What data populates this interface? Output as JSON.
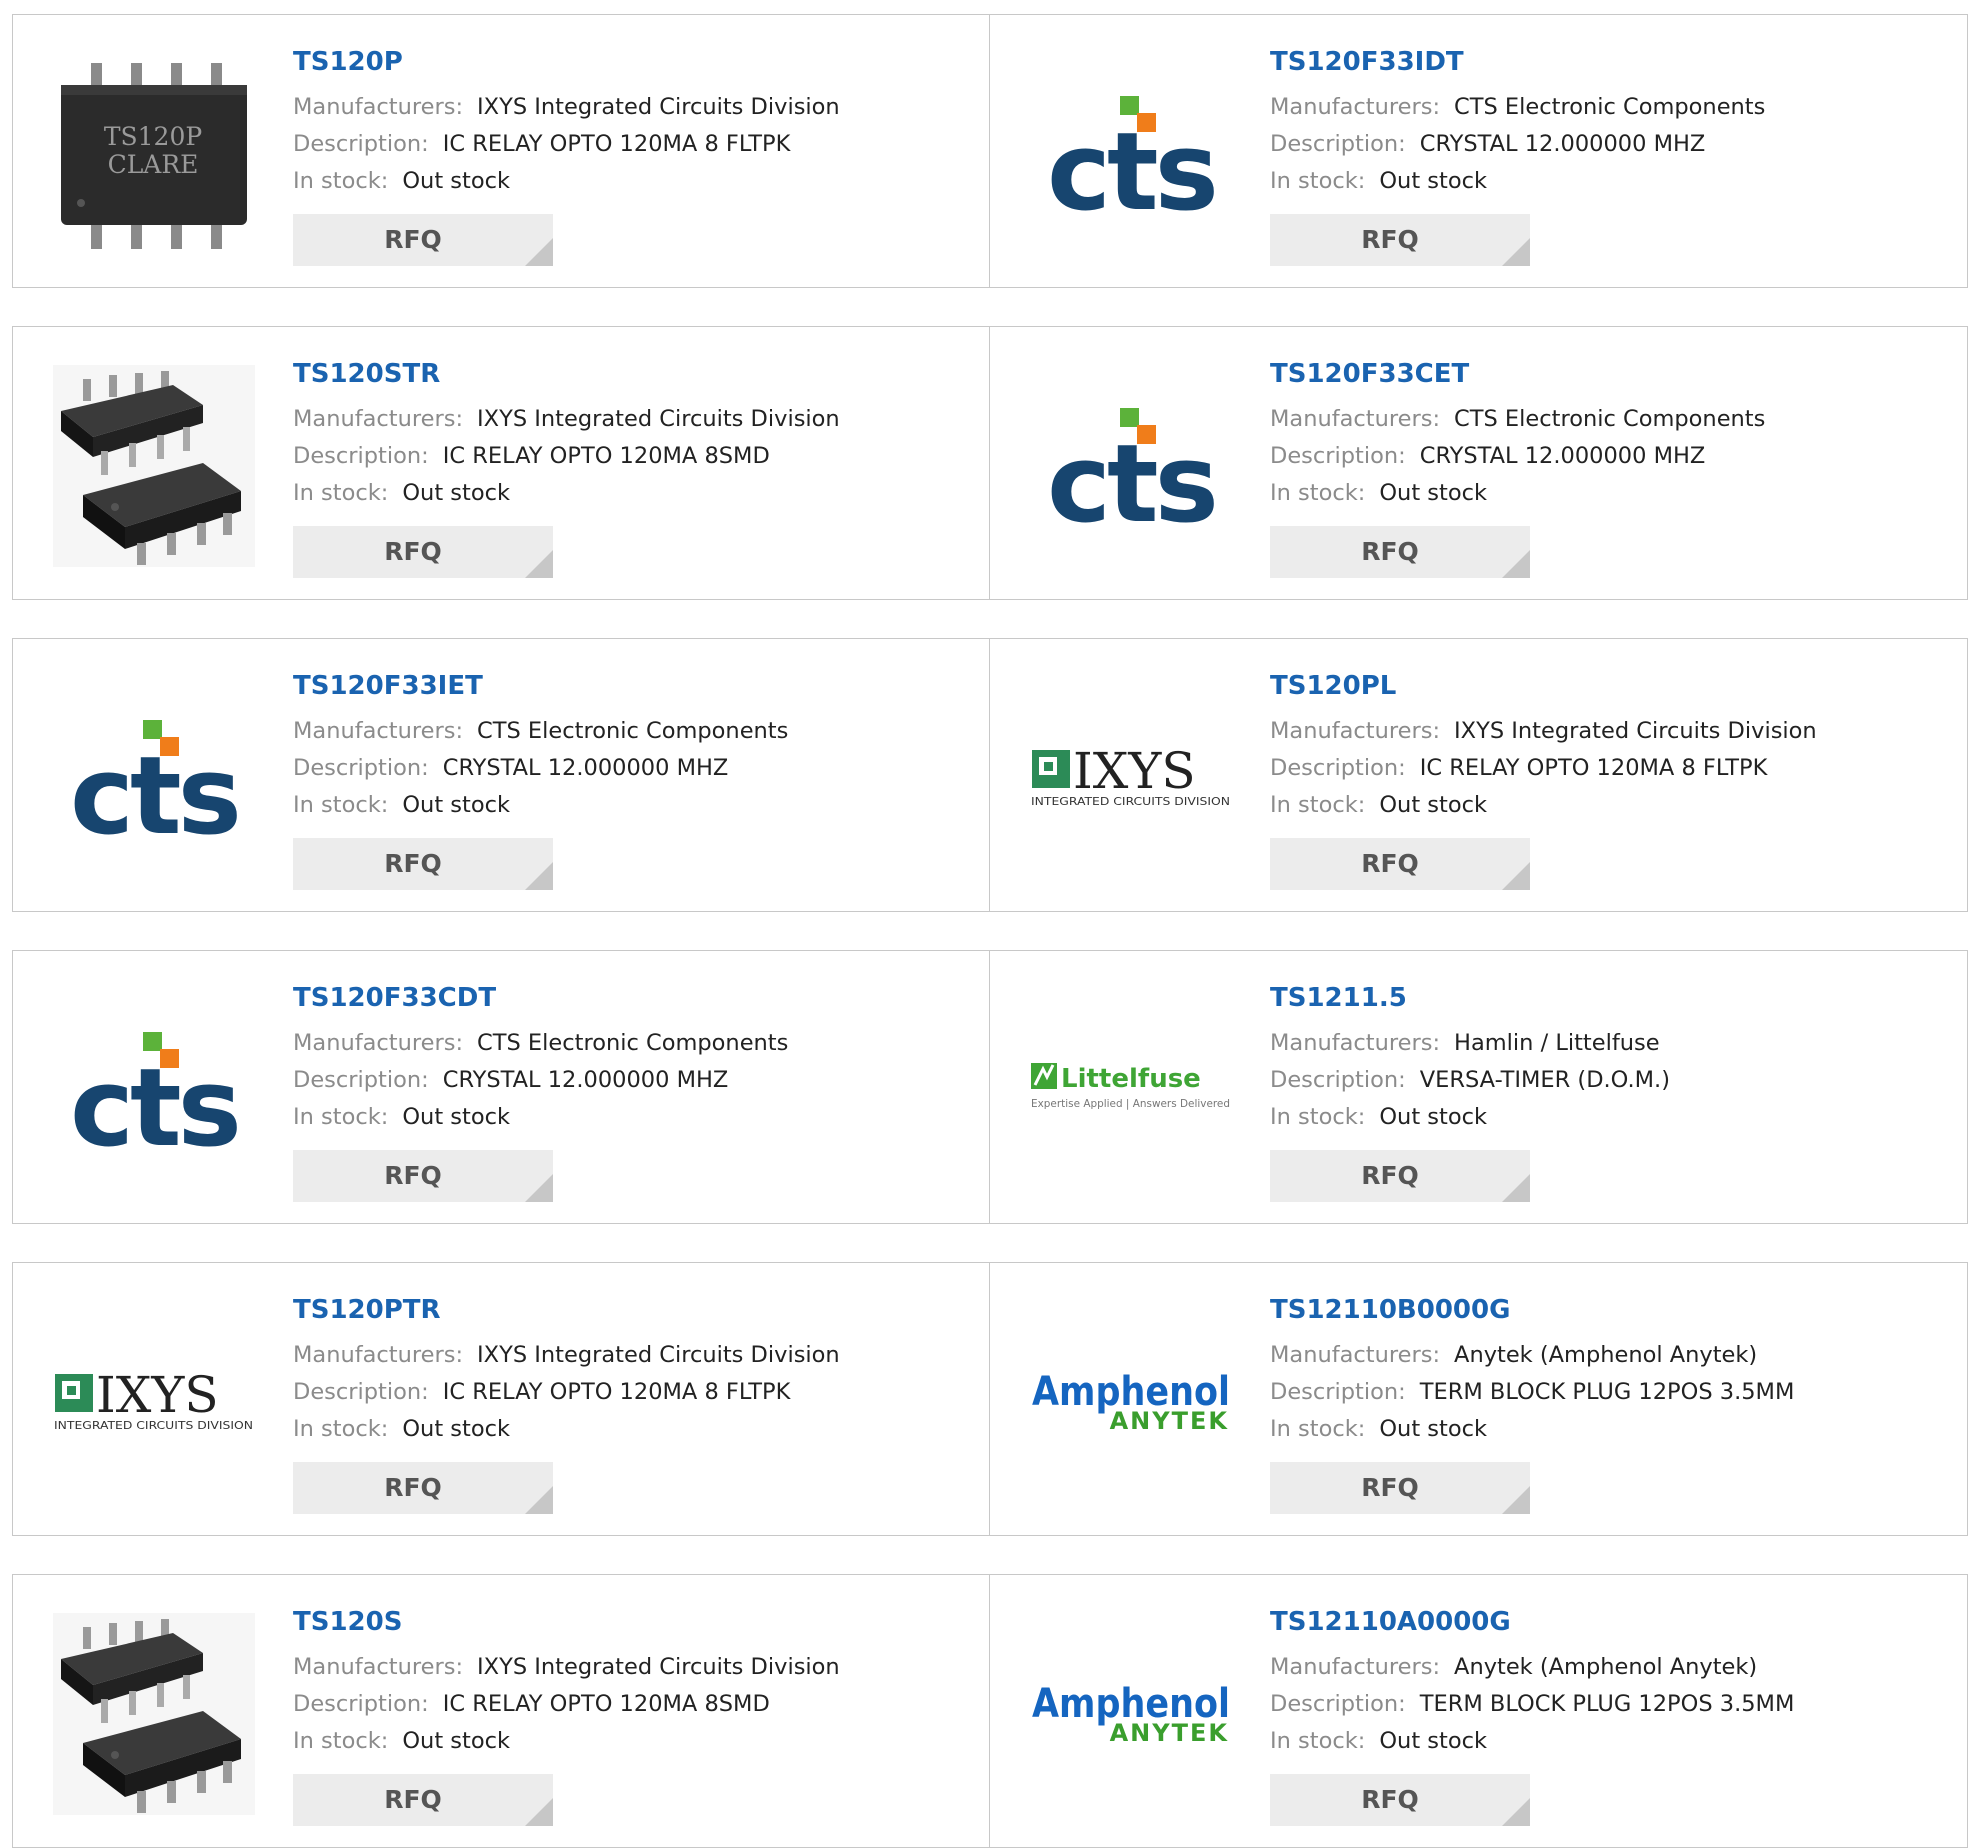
{
  "labels": {
    "manufacturers": "Manufacturers:",
    "description": "Description:",
    "in_stock": "In stock:",
    "rfq": "RFQ"
  },
  "colors": {
    "part_link": "#1a63b0",
    "label": "#8b8b8b",
    "value": "#222222",
    "rfq_bg": "#ececec",
    "cts_blue": "#17456f",
    "cts_green": "#5cb23a",
    "cts_orange": "#f07d1a",
    "ixys_green": "#2c8b57",
    "littelfuse_green": "#3fa535",
    "amphenol_blue": "#1565c0",
    "anytek_green": "#3a9e2d"
  },
  "products": [
    {
      "part": "TS120P",
      "manufacturer": "IXYS Integrated Circuits Division",
      "description": "IC RELAY OPTO 120MA 8 FLTPK",
      "stock": "Out stock",
      "image": "chip-dip8-photo",
      "chip_marking": [
        "TS120P",
        "CLARE"
      ]
    },
    {
      "part": "TS120F33IDT",
      "manufacturer": "CTS Electronic Components",
      "description": "CRYSTAL 12.000000 MHZ",
      "stock": "Out stock",
      "image": "cts-logo",
      "logo_text": "cts"
    },
    {
      "part": "TS120STR",
      "manufacturer": "IXYS Integrated Circuits Division",
      "description": "IC RELAY OPTO 120MA 8SMD",
      "stock": "Out stock",
      "image": "chip-smd8-photo"
    },
    {
      "part": "TS120F33CET",
      "manufacturer": "CTS Electronic Components",
      "description": "CRYSTAL 12.000000 MHZ",
      "stock": "Out stock",
      "image": "cts-logo",
      "logo_text": "cts"
    },
    {
      "part": "TS120F33IET",
      "manufacturer": "CTS Electronic Components",
      "description": "CRYSTAL 12.000000 MHZ",
      "stock": "Out stock",
      "image": "cts-logo",
      "logo_text": "cts"
    },
    {
      "part": "TS120PL",
      "manufacturer": "IXYS Integrated Circuits Division",
      "description": "IC RELAY OPTO 120MA 8 FLTPK",
      "stock": "Out stock",
      "image": "ixys-logo",
      "logo_text": "IXYS",
      "logo_sub": "INTEGRATED CIRCUITS DIVISION"
    },
    {
      "part": "TS120F33CDT",
      "manufacturer": "CTS Electronic Components",
      "description": "CRYSTAL 12.000000 MHZ",
      "stock": "Out stock",
      "image": "cts-logo",
      "logo_text": "cts"
    },
    {
      "part": "TS1211.5",
      "manufacturer": "Hamlin / Littelfuse",
      "description": "VERSA-TIMER (D.O.M.)",
      "stock": "Out stock",
      "image": "littelfuse-logo",
      "logo_text": "Littelfuse",
      "logo_sub": "Expertise Applied | Answers Delivered"
    },
    {
      "part": "TS120PTR",
      "manufacturer": "IXYS Integrated Circuits Division",
      "description": "IC RELAY OPTO 120MA 8 FLTPK",
      "stock": "Out stock",
      "image": "ixys-logo",
      "logo_text": "IXYS",
      "logo_sub": "INTEGRATED CIRCUITS DIVISION"
    },
    {
      "part": "TS12110B0000G",
      "manufacturer": "Anytek (Amphenol Anytek)",
      "description": "TERM BLOCK PLUG 12POS 3.5MM",
      "stock": "Out stock",
      "image": "amphenol-logo",
      "logo_text": "Amphenol",
      "logo_sub": "ANYTEK"
    },
    {
      "part": "TS120S",
      "manufacturer": "IXYS Integrated Circuits Division",
      "description": "IC RELAY OPTO 120MA 8SMD",
      "stock": "Out stock",
      "image": "chip-smd8-photo"
    },
    {
      "part": "TS12110A0000G",
      "manufacturer": "Anytek (Amphenol Anytek)",
      "description": "TERM BLOCK PLUG 12POS 3.5MM",
      "stock": "Out stock",
      "image": "amphenol-logo",
      "logo_text": "Amphenol",
      "logo_sub": "ANYTEK"
    }
  ]
}
